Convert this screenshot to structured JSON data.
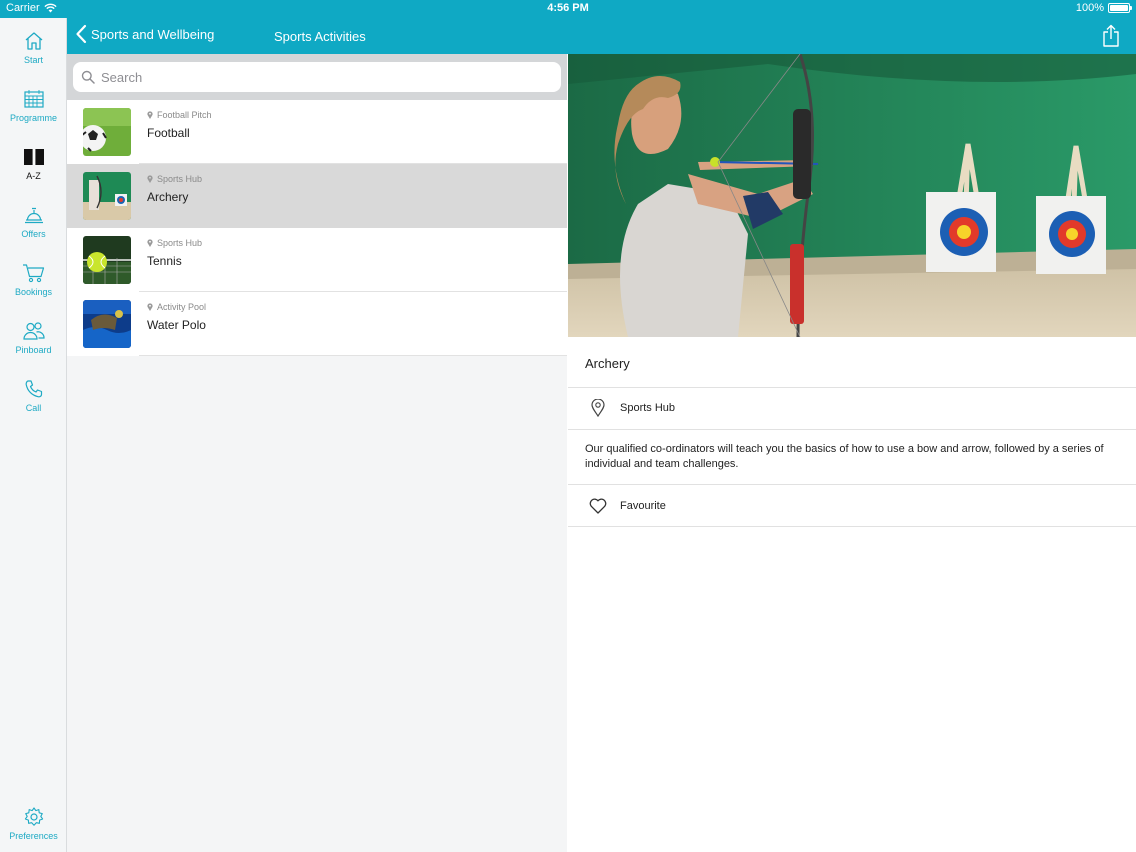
{
  "status": {
    "carrier": "Carrier",
    "time": "4:56 PM",
    "battery": "100%",
    "battery_level": 1.0
  },
  "sidebar": {
    "items": [
      {
        "label": "Start",
        "icon": "home-icon"
      },
      {
        "label": "Programme",
        "icon": "calendar-icon"
      },
      {
        "label": "A-Z",
        "icon": "book-icon"
      },
      {
        "label": "Offers",
        "icon": "bell-icon"
      },
      {
        "label": "Bookings",
        "icon": "cart-icon"
      },
      {
        "label": "Pinboard",
        "icon": "people-icon"
      },
      {
        "label": "Call",
        "icon": "phone-icon"
      }
    ],
    "preferences": {
      "label": "Preferences",
      "icon": "gear-icon"
    }
  },
  "nav": {
    "back_label": "Sports and Wellbeing",
    "title": "Sports Activities"
  },
  "search": {
    "placeholder": "Search"
  },
  "list": {
    "items": [
      {
        "location": "Football Pitch",
        "name": "Football",
        "selected": false
      },
      {
        "location": "Sports Hub",
        "name": "Archery",
        "selected": true
      },
      {
        "location": "Sports Hub",
        "name": "Tennis",
        "selected": false
      },
      {
        "location": "Activity Pool",
        "name": "Water Polo",
        "selected": false
      }
    ]
  },
  "detail": {
    "title": "Archery",
    "location": "Sports Hub",
    "description": "Our qualified co-ordinators will teach you the basics of how to use a bow and arrow, followed by a series of individual and team challenges.",
    "favourite_label": "Favourite"
  },
  "colors": {
    "accent": "#0fa9c4",
    "selected_row": "#d9d9d9"
  }
}
